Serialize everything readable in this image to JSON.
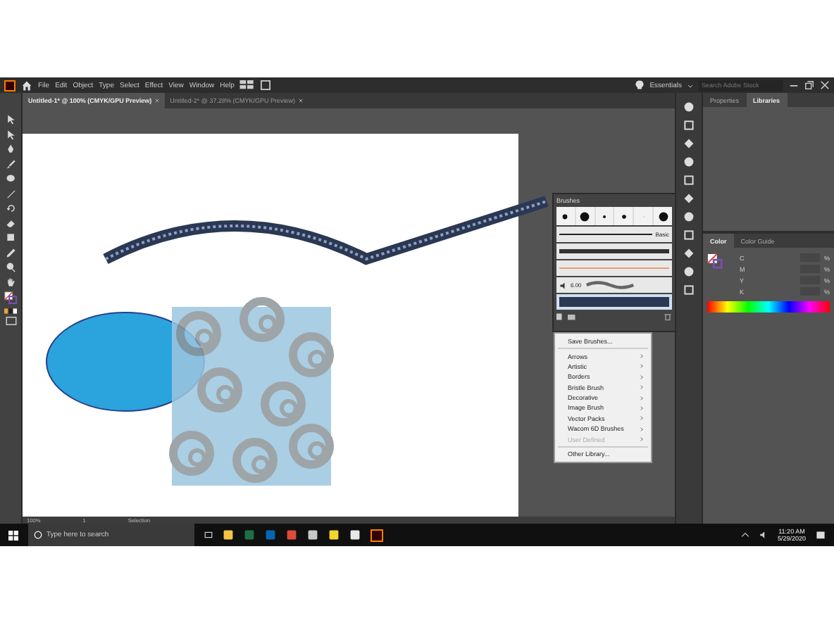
{
  "menu_bar": {
    "items": [
      "File",
      "Edit",
      "Object",
      "Type",
      "Select",
      "Effect",
      "View",
      "Window",
      "Help"
    ],
    "workspace": "Essentials",
    "search": {
      "placeholder": "Search Adobe Stock"
    }
  },
  "document_tabs": [
    {
      "label": "Untitled-1* @ 100% (CMYK/GPU Preview)",
      "selected": true
    },
    {
      "label": "Untitled-2* @ 37.28% (CMYK/GPU Preview)",
      "selected": false
    }
  ],
  "right_panel": {
    "tabs": [
      {
        "label": "Properties",
        "selected": false
      },
      {
        "label": "Libraries",
        "selected": true
      }
    ]
  },
  "color_panel": {
    "tabs": [
      {
        "label": "Color",
        "selected": true
      },
      {
        "label": "Color Guide",
        "selected": false
      }
    ],
    "channels": [
      {
        "label": "C",
        "unit": "%"
      },
      {
        "label": "M",
        "unit": "%"
      },
      {
        "label": "Y",
        "unit": "%"
      },
      {
        "label": "K",
        "unit": "%"
      }
    ]
  },
  "brushes_panel": {
    "title": "Brushes",
    "basic_label": "Basic",
    "size_label": "6.00",
    "rows": [
      {
        "kind": "basic",
        "selected": false
      },
      {
        "kind": "rough",
        "selected": false
      },
      {
        "kind": "arrow",
        "selected": false
      },
      {
        "kind": "bristle",
        "selected": false
      },
      {
        "kind": "border",
        "selected": true
      }
    ]
  },
  "brush_library_menu": {
    "items": [
      {
        "label": "Save Brushes...",
        "kind": "action",
        "disabled": false
      },
      {
        "label": "Arrows",
        "kind": "submenu",
        "disabled": false
      },
      {
        "label": "Artistic",
        "kind": "submenu",
        "disabled": false
      },
      {
        "label": "Borders",
        "kind": "submenu",
        "disabled": false
      },
      {
        "label": "Bristle Brush",
        "kind": "submenu",
        "disabled": false
      },
      {
        "label": "Decorative",
        "kind": "submenu",
        "disabled": false
      },
      {
        "label": "Image Brush",
        "kind": "submenu",
        "disabled": false
      },
      {
        "label": "Vector Packs",
        "kind": "submenu",
        "disabled": false
      },
      {
        "label": "Wacom 6D Brushes",
        "kind": "submenu",
        "disabled": false
      },
      {
        "label": "User Defined",
        "kind": "submenu",
        "disabled": true
      },
      {
        "label": "Other Library...",
        "kind": "action",
        "disabled": false
      }
    ]
  },
  "status_bar": {
    "zoom": "100%",
    "artboard": "1",
    "tool": "Selection"
  },
  "taskbar": {
    "search": {
      "placeholder": "Type here to search"
    },
    "time": "11:20 AM",
    "date": "5/29/2020"
  }
}
